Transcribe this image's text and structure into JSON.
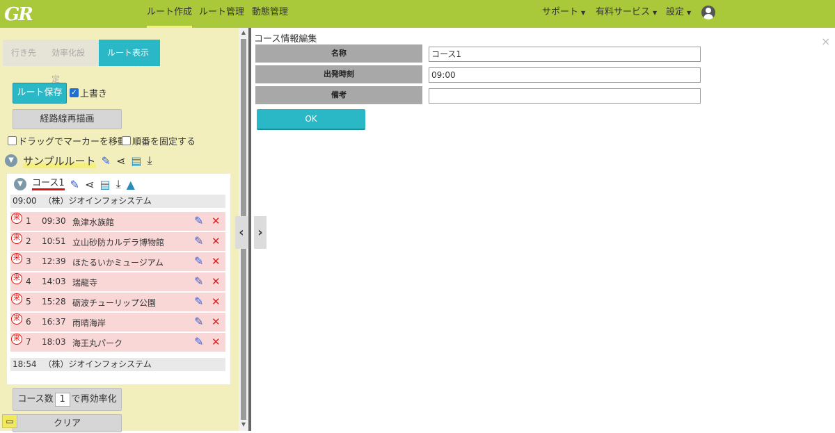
{
  "header": {
    "logo": "GR",
    "nav": [
      "ルート作成",
      "ルート管理",
      "動態管理"
    ],
    "right_nav": [
      "サポート",
      "有料サービス",
      "設定"
    ]
  },
  "steps": [
    "行き先",
    "効率化設定",
    "ルート表示"
  ],
  "left": {
    "save_label": "ルート保存",
    "overwrite_label": "上書き",
    "redraw_label": "経路線再描画",
    "drag_label": "ドラッグでマーカーを移動",
    "fix_order_label": "順番を固定する",
    "route_name": "サンプルルート",
    "course_name": "コース1",
    "start": {
      "time": "09:00",
      "name": "（株）ジオインフォシステム"
    },
    "stops": [
      {
        "num": "1",
        "time": "09:30",
        "name": "魚津水族館"
      },
      {
        "num": "2",
        "time": "10:51",
        "name": "立山砂防カルデラ博物館"
      },
      {
        "num": "3",
        "time": "12:39",
        "name": "ほたるいかミュージアム"
      },
      {
        "num": "4",
        "time": "14:03",
        "name": "瑞龍寺"
      },
      {
        "num": "5",
        "time": "15:28",
        "name": "砺波チューリップ公園"
      },
      {
        "num": "6",
        "time": "16:37",
        "name": "雨晴海岸"
      },
      {
        "num": "7",
        "time": "18:03",
        "name": "海王丸パーク"
      }
    ],
    "end": {
      "time": "18:54",
      "name": "（株）ジオインフォシステム"
    },
    "course_count_prefix": "コース数",
    "course_count_value": "1",
    "course_count_suffix": "で再効率化",
    "clear_label": "クリア"
  },
  "form": {
    "title": "コース情報編集",
    "name_label": "名称",
    "name_value": "コース1",
    "depart_label": "出発時刻",
    "depart_value": "09:00",
    "note_label": "備考",
    "note_value": "",
    "ok_label": "OK"
  }
}
